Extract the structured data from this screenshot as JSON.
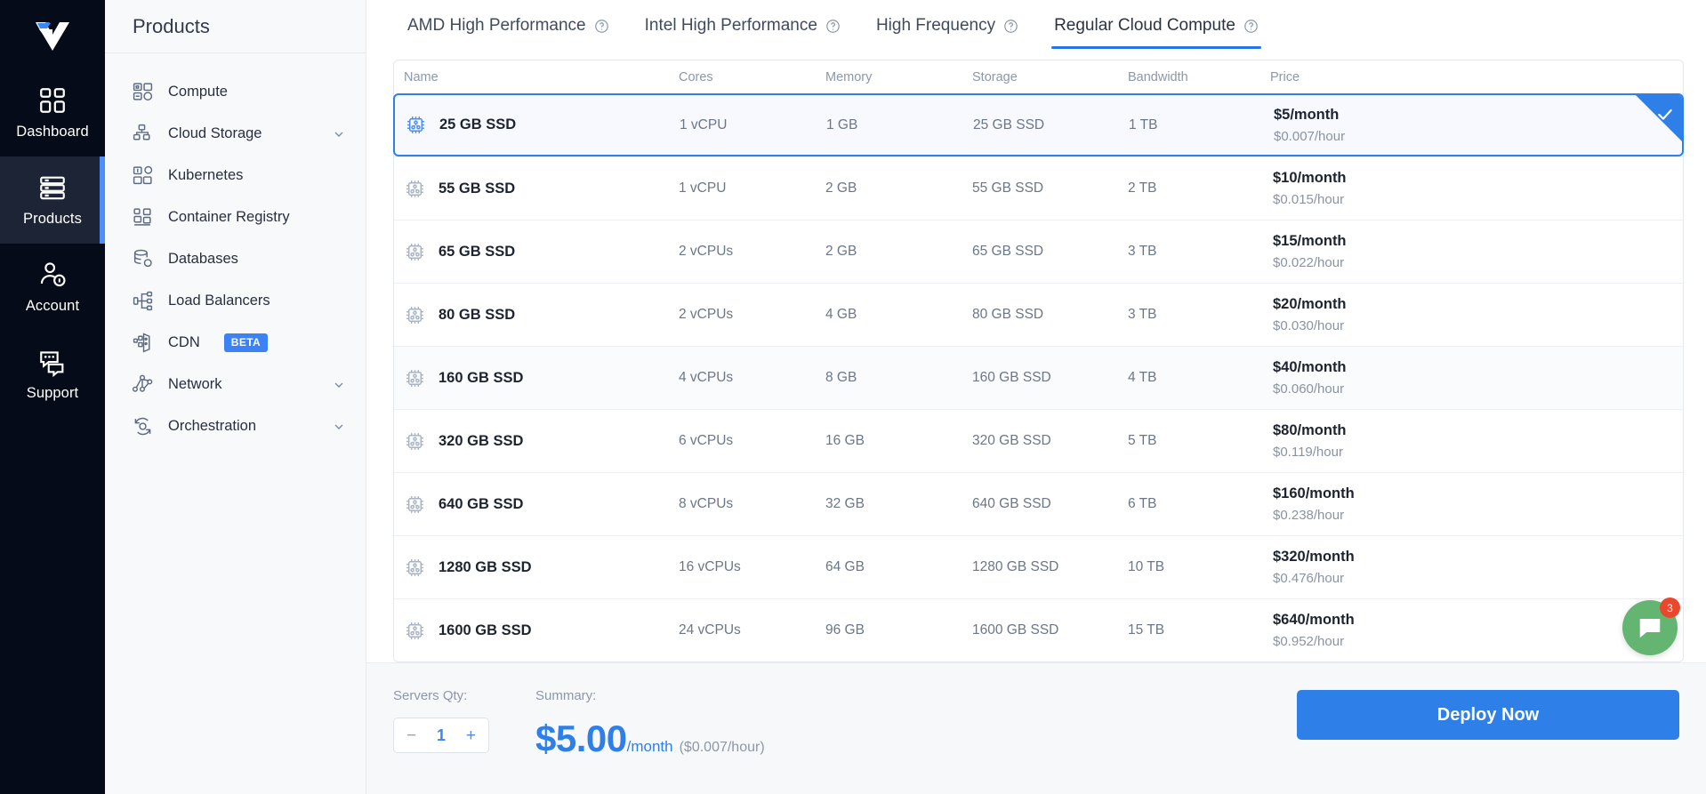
{
  "rail": {
    "logo_name": "vultr-logo",
    "items": [
      {
        "label": "Dashboard",
        "icon": "grid-icon",
        "active": false
      },
      {
        "label": "Products",
        "icon": "server-stack-icon",
        "active": true
      },
      {
        "label": "Account",
        "icon": "user-key-icon",
        "active": false
      },
      {
        "label": "Support",
        "icon": "chat-bubbles-icon",
        "active": false
      }
    ]
  },
  "products": {
    "title": "Products",
    "items": [
      {
        "label": "Compute",
        "icon": "compute-icon",
        "chevron": false,
        "badge": ""
      },
      {
        "label": "Cloud Storage",
        "icon": "cloud-storage-icon",
        "chevron": true,
        "badge": ""
      },
      {
        "label": "Kubernetes",
        "icon": "kubernetes-icon",
        "chevron": false,
        "badge": ""
      },
      {
        "label": "Container Registry",
        "icon": "container-registry-icon",
        "chevron": false,
        "badge": ""
      },
      {
        "label": "Databases",
        "icon": "database-icon",
        "chevron": false,
        "badge": ""
      },
      {
        "label": "Load Balancers",
        "icon": "load-balancer-icon",
        "chevron": false,
        "badge": ""
      },
      {
        "label": "CDN",
        "icon": "cdn-icon",
        "chevron": false,
        "badge": "BETA"
      },
      {
        "label": "Network",
        "icon": "network-icon",
        "chevron": true,
        "badge": ""
      },
      {
        "label": "Orchestration",
        "icon": "orchestration-icon",
        "chevron": true,
        "badge": ""
      }
    ]
  },
  "tabs": [
    {
      "label": "AMD High Performance",
      "active": false
    },
    {
      "label": "Intel High Performance",
      "active": false
    },
    {
      "label": "High Frequency",
      "active": false
    },
    {
      "label": "Regular Cloud Compute",
      "active": true
    }
  ],
  "table": {
    "headers": [
      "Name",
      "Cores",
      "Memory",
      "Storage",
      "Bandwidth",
      "Price"
    ],
    "rows": [
      {
        "name": "25 GB SSD",
        "cores": "1 vCPU",
        "memory": "1 GB",
        "storage": "25 GB SSD",
        "bandwidth": "1 TB",
        "price_month": "$5/month",
        "price_hour": "$0.007/hour",
        "selected": true
      },
      {
        "name": "55 GB SSD",
        "cores": "1 vCPU",
        "memory": "2 GB",
        "storage": "55 GB SSD",
        "bandwidth": "2 TB",
        "price_month": "$10/month",
        "price_hour": "$0.015/hour",
        "selected": false
      },
      {
        "name": "65 GB SSD",
        "cores": "2 vCPUs",
        "memory": "2 GB",
        "storage": "65 GB SSD",
        "bandwidth": "3 TB",
        "price_month": "$15/month",
        "price_hour": "$0.022/hour",
        "selected": false
      },
      {
        "name": "80 GB SSD",
        "cores": "2 vCPUs",
        "memory": "4 GB",
        "storage": "80 GB SSD",
        "bandwidth": "3 TB",
        "price_month": "$20/month",
        "price_hour": "$0.030/hour",
        "selected": false
      },
      {
        "name": "160 GB SSD",
        "cores": "4 vCPUs",
        "memory": "8 GB",
        "storage": "160 GB SSD",
        "bandwidth": "4 TB",
        "price_month": "$40/month",
        "price_hour": "$0.060/hour",
        "selected": false
      },
      {
        "name": "320 GB SSD",
        "cores": "6 vCPUs",
        "memory": "16 GB",
        "storage": "320 GB SSD",
        "bandwidth": "5 TB",
        "price_month": "$80/month",
        "price_hour": "$0.119/hour",
        "selected": false
      },
      {
        "name": "640 GB SSD",
        "cores": "8 vCPUs",
        "memory": "32 GB",
        "storage": "640 GB SSD",
        "bandwidth": "6 TB",
        "price_month": "$160/month",
        "price_hour": "$0.238/hour",
        "selected": false
      },
      {
        "name": "1280 GB SSD",
        "cores": "16 vCPUs",
        "memory": "64 GB",
        "storage": "1280 GB SSD",
        "bandwidth": "10 TB",
        "price_month": "$320/month",
        "price_hour": "$0.476/hour",
        "selected": false
      },
      {
        "name": "1600 GB SSD",
        "cores": "24 vCPUs",
        "memory": "96 GB",
        "storage": "1600 GB SSD",
        "bandwidth": "15 TB",
        "price_month": "$640/month",
        "price_hour": "$0.952/hour",
        "selected": false
      }
    ]
  },
  "footer": {
    "qty_label": "Servers Qty:",
    "qty_value": "1",
    "minus": "−",
    "plus": "+",
    "summary_label": "Summary:",
    "summary_price": "$5.00",
    "summary_period": "/month",
    "summary_hourly": "($0.007/hour)",
    "deploy_label": "Deploy Now",
    "chat_badge": "3"
  },
  "colors": {
    "accent": "#2f7fe8",
    "rail_bg": "#060b1a",
    "rail_active": "#1c2435",
    "beta_badge": "#3b82f6",
    "chat_fab": "#64b571",
    "chat_badge": "#e8482e"
  }
}
